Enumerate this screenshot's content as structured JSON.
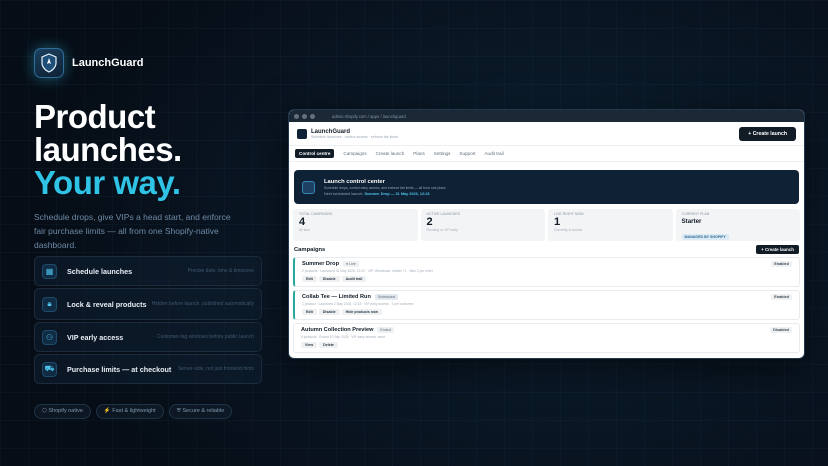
{
  "brand": {
    "name": "LaunchGuard"
  },
  "hero": {
    "line1": "Product",
    "line2": "launches.",
    "line3": "Your way."
  },
  "subtitle": "Schedule drops, give VIPs a head start, and enforce fair purchase limits — all from one Shopify-native dashboard.",
  "features": [
    {
      "icon": "calendar-icon",
      "title": "Schedule launches",
      "desc": "Precise date, time & timezone"
    },
    {
      "icon": "lock-icon",
      "title": "Lock & reveal products",
      "desc": "Hidden before launch, published automatically"
    },
    {
      "icon": "users-icon",
      "title": "VIP early access",
      "desc": "Customer-tag windows before public launch"
    },
    {
      "icon": "cart-icon",
      "title": "Purchase limits — at checkout",
      "desc": "Server-side, not just frontend hints"
    }
  ],
  "pills": [
    "Shopify native",
    "Fast & lightweight",
    "Secure & reliable"
  ],
  "app": {
    "url": "admin.shopify.com / apps / launchguard",
    "name": "LaunchGuard",
    "tagline": "Schedule launches · control access · enforce fair limits",
    "create_label": "+ Create launch",
    "tabs": [
      "Control centre",
      "Campaigns",
      "Create launch",
      "Plans",
      "Settings",
      "Support",
      "Audit trail"
    ],
    "banner": {
      "title": "Launch control center",
      "sub": "Schedule drops, control early access, and enforce fair limits — all from one place.",
      "next_label": "Next scheduled launch:",
      "next_value": "Summer Drop — 31 May 2026, 12:23"
    },
    "stats": [
      {
        "label": "Total campaigns",
        "value": "4",
        "hint": "All time"
      },
      {
        "label": "Active launches",
        "value": "2",
        "hint": "Running or VIP early"
      },
      {
        "label": "Live right now",
        "value": "1",
        "hint": "Currently in launch"
      },
      {
        "label": "Current plan",
        "value": "Starter",
        "badge": "MANAGED BY SHOPIFY"
      }
    ],
    "campaigns_title": "Campaigns",
    "campaigns_create": "+ Create launch",
    "campaigns": [
      {
        "name": "Summer Drop",
        "status": "● Live",
        "enabled": "Enabled",
        "meta": "2 products · Launched 31 May 2026, 12:23 · VIP: Wholesale, Insider +1 · Max 2 per order",
        "actions": [
          "Edit",
          "Disable",
          "Audit trail"
        ]
      },
      {
        "name": "Collab Tee — Limited Run",
        "status": "Scheduled",
        "enabled": "Enabled",
        "meta": "1 product · Launches 2 May 2026, 12:33 · VIP early access · 1 per customer",
        "actions": [
          "Edit",
          "Disable",
          "Hide products now"
        ]
      },
      {
        "name": "Autumn Collection Preview",
        "status": "Ended",
        "enabled": "Disabled",
        "meta": "6 products · Ended 10 Sep 2025 · VIP early access, none",
        "actions": [
          "View",
          "Delete"
        ]
      }
    ]
  }
}
